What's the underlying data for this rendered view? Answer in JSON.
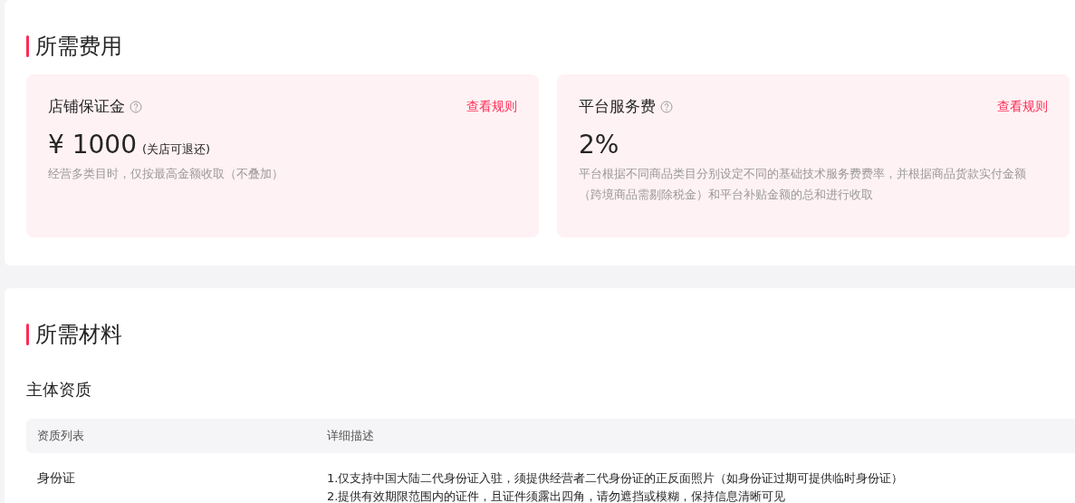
{
  "fees_section": {
    "title": "所需费用",
    "cards": [
      {
        "title": "店铺保证金",
        "rules_link": "查看规则",
        "amount": "¥ 1000",
        "amount_note": "(关店可退还)",
        "description": "经营多类目时，仅按最高金额收取（不叠加）"
      },
      {
        "title": "平台服务费",
        "rules_link": "查看规则",
        "amount": "2%",
        "description": "平台根据不同商品类目分别设定不同的基础技术服务费费率，并根据商品货款实付金额（跨境商品需剔除税金）和平台补贴金额的总和进行收取"
      }
    ]
  },
  "materials_section": {
    "title": "所需材料",
    "subtitle": "主体资质",
    "table": {
      "columns": [
        "资质列表",
        "详细描述"
      ],
      "rows": [
        {
          "name": "身份证",
          "details": [
            "1.仅支持中国大陆二代身份证入驻，须提供经营者二代身份证的正反面照片（如身份证过期可提供临时身份证）",
            "2.提供有效期限范围内的证件，且证件须露出四角，请勿遮挡或模糊，保持信息清晰可见"
          ]
        }
      ]
    }
  }
}
